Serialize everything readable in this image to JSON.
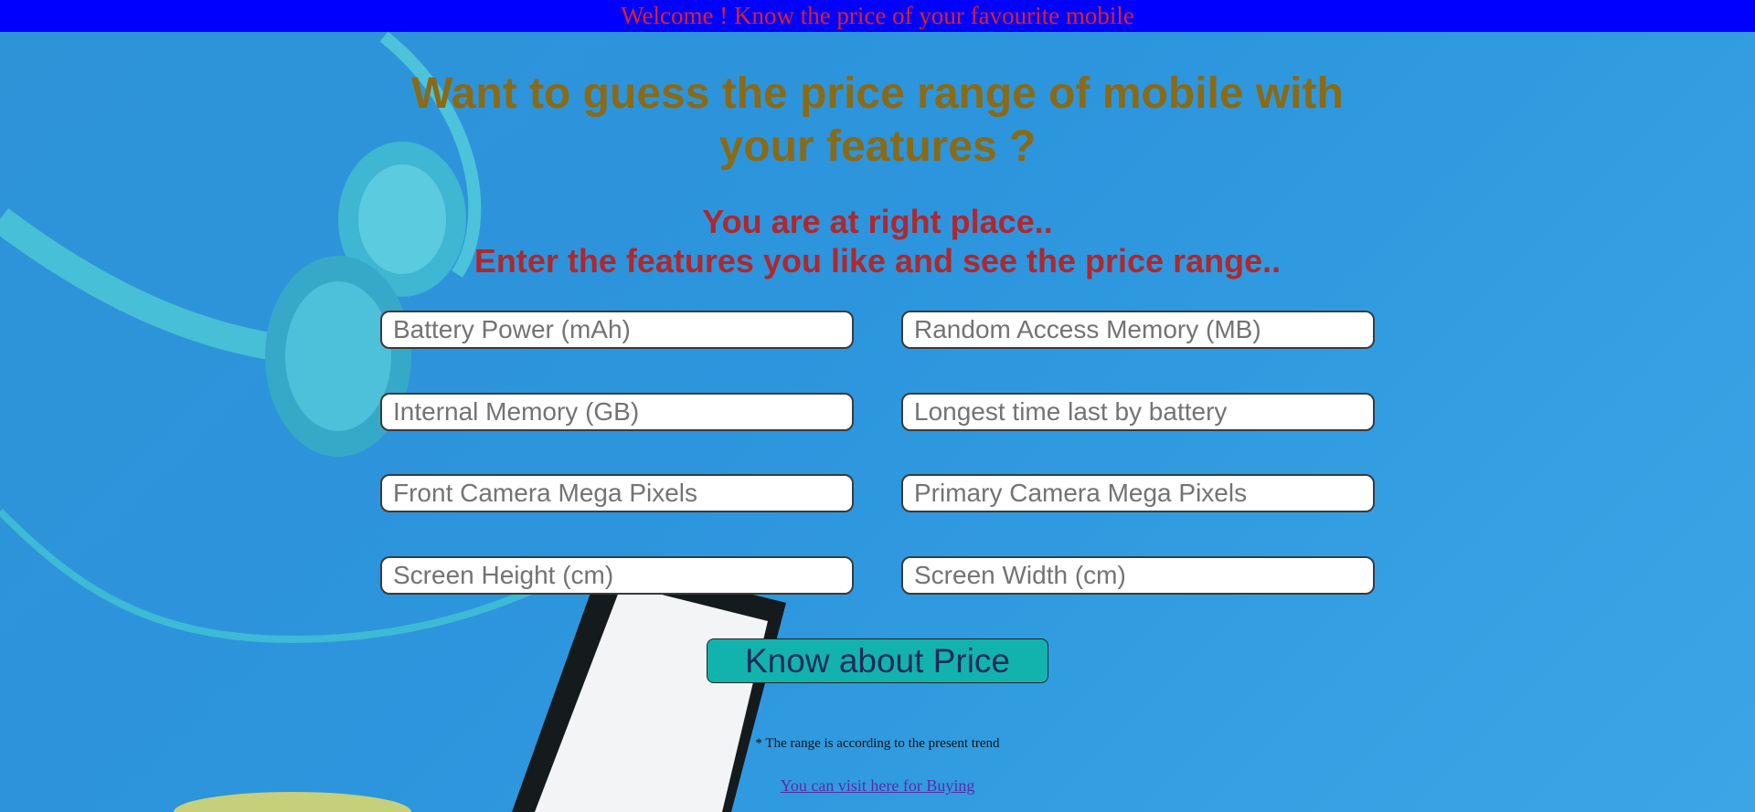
{
  "banner": {
    "text": "Welcome ! Know the price of your favourite mobile"
  },
  "header": {
    "title": "Want to guess the price range of mobile with your features ?",
    "subtitle_line1": "You are at right place..",
    "subtitle_line2": "Enter the features you like and see the price range.."
  },
  "form": {
    "fields": [
      {
        "placeholder": "Battery Power (mAh)",
        "value": ""
      },
      {
        "placeholder": "Random Access Memory (MB)",
        "value": ""
      },
      {
        "placeholder": "Internal Memory (GB)",
        "value": ""
      },
      {
        "placeholder": "Longest time last by battery",
        "value": ""
      },
      {
        "placeholder": "Front Camera Mega Pixels",
        "value": ""
      },
      {
        "placeholder": "Primary Camera Mega Pixels",
        "value": ""
      },
      {
        "placeholder": "Screen Height (cm)",
        "value": ""
      },
      {
        "placeholder": "Screen Width (cm)",
        "value": ""
      }
    ],
    "submit_label": "Know about Price"
  },
  "footer": {
    "note": "* The range is according to the present trend",
    "link_text": "You can visit here for Buying"
  },
  "colors": {
    "banner_bg": "#0000ff",
    "banner_text": "#e01f2a",
    "title": "#8a6a14",
    "subtitle": "#b0272c",
    "button_bg": "#12b3ad",
    "page_bg": "#2f93d8"
  }
}
